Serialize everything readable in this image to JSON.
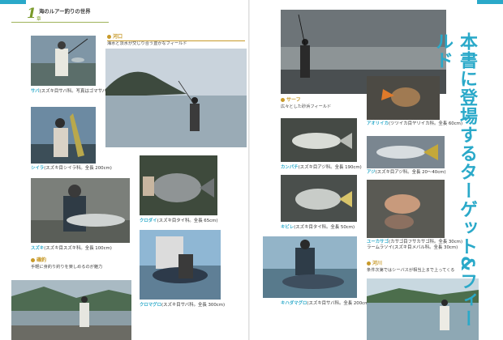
{
  "chapter": {
    "number": "1",
    "title": "海のルアー釣りの世界",
    "label": "章"
  },
  "vertical_title": "本書に登場するターゲット&フィールド",
  "sections": {
    "kakou": {
      "heading": "河口",
      "sub": "海水と淡水が交じり合う豊かなフィールド"
    },
    "iso": {
      "heading": "磯釣",
      "sub": "手軽に身釣り釣りを楽しめるのが魅力"
    },
    "surf": {
      "heading": "サーフ",
      "sub": "広々とした砂浜フィールド"
    },
    "kasen": {
      "heading": "河川",
      "sub": "条件次第ではシーバスが相当上まで上ってくる"
    }
  },
  "captions": {
    "saba": {
      "name": "サバ",
      "text": "(スズキ目サバ科。写真はゴマサバ。全長 50cm)"
    },
    "shiira": {
      "name": "シイラ",
      "text": "(スズキ目シイラ科。全長 200cm)"
    },
    "suzuki": {
      "name": "スズキ",
      "text": "(スズキ目スズキ科。全長 100cm)"
    },
    "kurodai": {
      "name": "クロダイ",
      "text": "(スズキ目タイ科。全長 65cm)"
    },
    "kuromaguro": {
      "name": "クロマグロ",
      "text": "(スズキ目サバ科。全長 300cm)"
    },
    "kanpachi": {
      "name": "カンパチ",
      "text": "(スズキ目アジ科。全長 190cm)"
    },
    "kichiji": {
      "name": "キビレ",
      "text": "(スズキ目タイ科。全長 50cm)"
    },
    "kihada": {
      "name": "キハダマグロ",
      "text": "(スズキ目サバ科。全長 200cm)"
    },
    "aoriika": {
      "name": "アオリイカ",
      "text": "(ツツイカ目ヤリイカ科。全長 60cm)"
    },
    "aji": {
      "name": "アジ",
      "text": "(スズキ目アジ科。全長 20〜40cm)"
    },
    "ainame": {
      "name": "ユーカサゴ",
      "text": "(カサゴ目フサカサゴ科。全長 30cm)"
    },
    "ainame2": {
      "name": "",
      "text": "ラームラソイ(スズキ目メバル科。全長 30cm)"
    }
  },
  "colors": {
    "accent": "#2aa9c9",
    "section": "#c89a2a",
    "chapter": "#7a9a2a"
  }
}
